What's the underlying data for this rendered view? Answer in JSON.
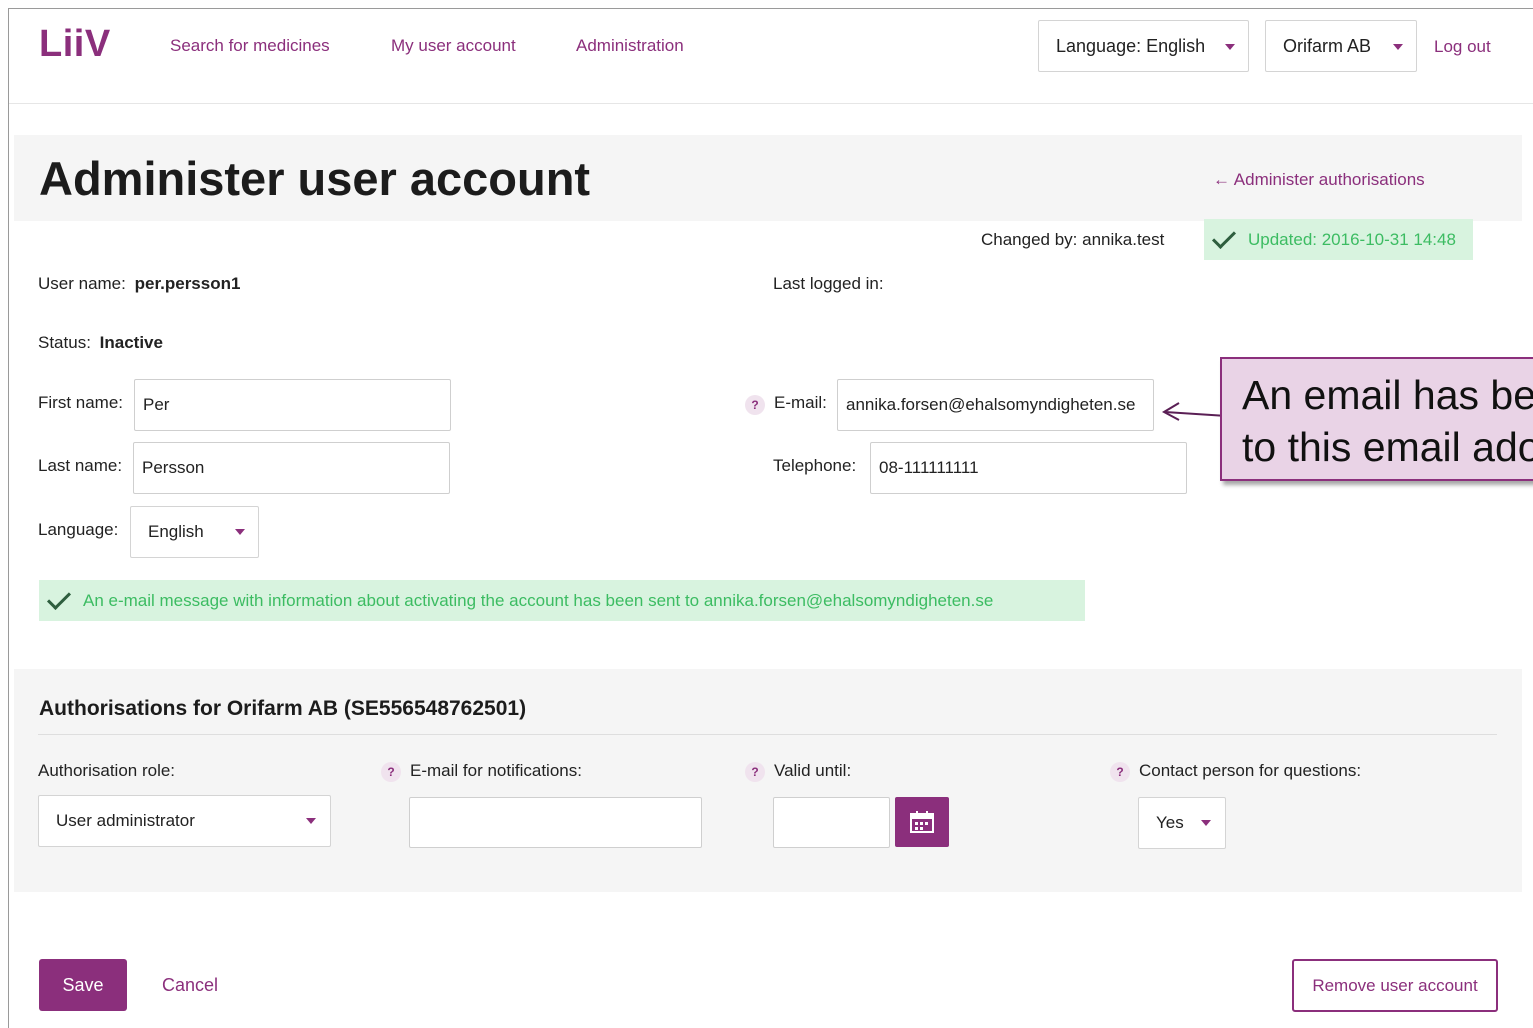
{
  "header": {
    "logo": "LiiV",
    "nav": [
      "Search for medicines",
      "My user account",
      "Administration"
    ],
    "language_select": "Language: English",
    "org_select": "Orifarm AB",
    "logout": "Log out"
  },
  "page": {
    "title": "Administer user account",
    "back_link": "← Administer authorisations",
    "changed_by": "Changed by: annika.test",
    "updated": "Updated: 2016-10-31 14:48"
  },
  "user": {
    "username_label": "User name:",
    "username": "per.persson1",
    "last_logged_label": "Last logged in:",
    "status_label": "Status:",
    "status": "Inactive",
    "first_name_label": "First name:",
    "first_name": "Per",
    "last_name_label": "Last name:",
    "last_name": "Persson",
    "language_label": "Language:",
    "language": "English",
    "email_label": "E-mail:",
    "email": "annika.forsen@ehalsomyndigheten.se",
    "telephone_label": "Telephone:",
    "telephone": "08-111111111"
  },
  "notice": "An e-mail message with information about activating the account has been sent to annika.forsen@ehalsomyndigheten.se",
  "authorisations": {
    "heading": "Authorisations for Orifarm AB (SE556548762501)",
    "role_label": "Authorisation role:",
    "role": "User administrator",
    "notify_email_label": "E-mail for notifications:",
    "notify_email": "",
    "valid_until_label": "Valid until:",
    "valid_until": "",
    "contact_label": "Contact person for questions:",
    "contact": "Yes"
  },
  "actions": {
    "save": "Save",
    "cancel": "Cancel",
    "remove": "Remove user account"
  },
  "callout": {
    "text": "An email has be\nto this email ado"
  },
  "help_glyph": "?",
  "colors": {
    "accent": "#8b2f7c",
    "success_bg": "#d8f3df",
    "success_text": "#3cbc62"
  }
}
